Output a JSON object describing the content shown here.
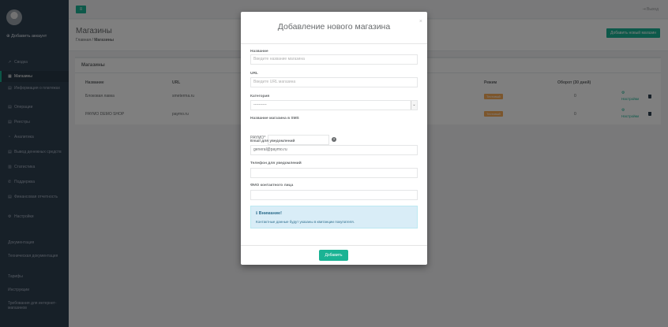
{
  "sidebar": {
    "add_account": "Добавить аккаунт",
    "items": [
      {
        "label": "Сводка",
        "icon": "chart-line-icon"
      },
      {
        "label": "Магазины",
        "icon": "store-icon"
      },
      {
        "label": "Информация о платежах",
        "icon": "document-icon"
      },
      {
        "label": "Операции",
        "icon": "list-icon"
      },
      {
        "label": "Реестры",
        "icon": "book-icon"
      },
      {
        "label": "Аналитика",
        "icon": "analytics-icon"
      },
      {
        "label": "Вывод денежных средств",
        "icon": "wallet-icon"
      },
      {
        "label": "Статистика",
        "icon": "bar-chart-icon"
      },
      {
        "label": "Поддержка",
        "icon": "phone-icon"
      },
      {
        "label": "Финансовая отчетность",
        "icon": "file-icon"
      },
      {
        "label": "Настройки",
        "icon": "gear-icon"
      }
    ],
    "bottom_items": [
      {
        "label": "Документация"
      },
      {
        "label": "Техническая документация"
      },
      {
        "label": "Тарифы"
      },
      {
        "label": "Инструкции"
      },
      {
        "label": "Требования для интернет-магазинов"
      }
    ]
  },
  "topbar": {
    "logout": "Выход"
  },
  "heading": {
    "title": "Магазины",
    "breadcrumb_home": "Главная",
    "breadcrumb_sep": "/",
    "breadcrumb_current": "Магазины",
    "add_button": "Добавить новый магазин"
  },
  "panel": {
    "title": "Магазины",
    "columns": [
      "Название",
      "URL",
      "Режим",
      "Оборот (30 дней)"
    ],
    "rows": [
      {
        "name": "Блоковая лавка",
        "url": "smeterma.ru",
        "mode": "Тестовый",
        "turnover": "0",
        "settings": "Настройки"
      },
      {
        "name": "PAYMO DEMO SHOP",
        "url": "paymo.ru",
        "mode": "Тестовый",
        "turnover": "0",
        "settings": "Настройки"
      }
    ]
  },
  "modal": {
    "title": "Добавление нового магазина",
    "close": "×",
    "name_label": "Название",
    "name_placeholder": "Введите название магазина",
    "url_label": "URL",
    "url_placeholder": "Введите URL магазина",
    "category_label": "Категория",
    "category_value": "----------",
    "sms_label": "Название магазина в SMS",
    "sms_prefix": "PAYMO*",
    "email_label": "Email для уведомлений",
    "email_value": "general@paymo.ru",
    "phone_label": "Телефон для уведомлений",
    "contact_label": "ФИО контактного лица",
    "alert_title": "Внимание!",
    "alert_text": "Контактные данные будут указаны в квитанции покупателя.",
    "submit": "Добавить"
  },
  "colors": {
    "accent": "#1ab394",
    "sidebar": "#2f4050",
    "warning": "#f8ac59",
    "alert_bg": "#d9edf7"
  }
}
